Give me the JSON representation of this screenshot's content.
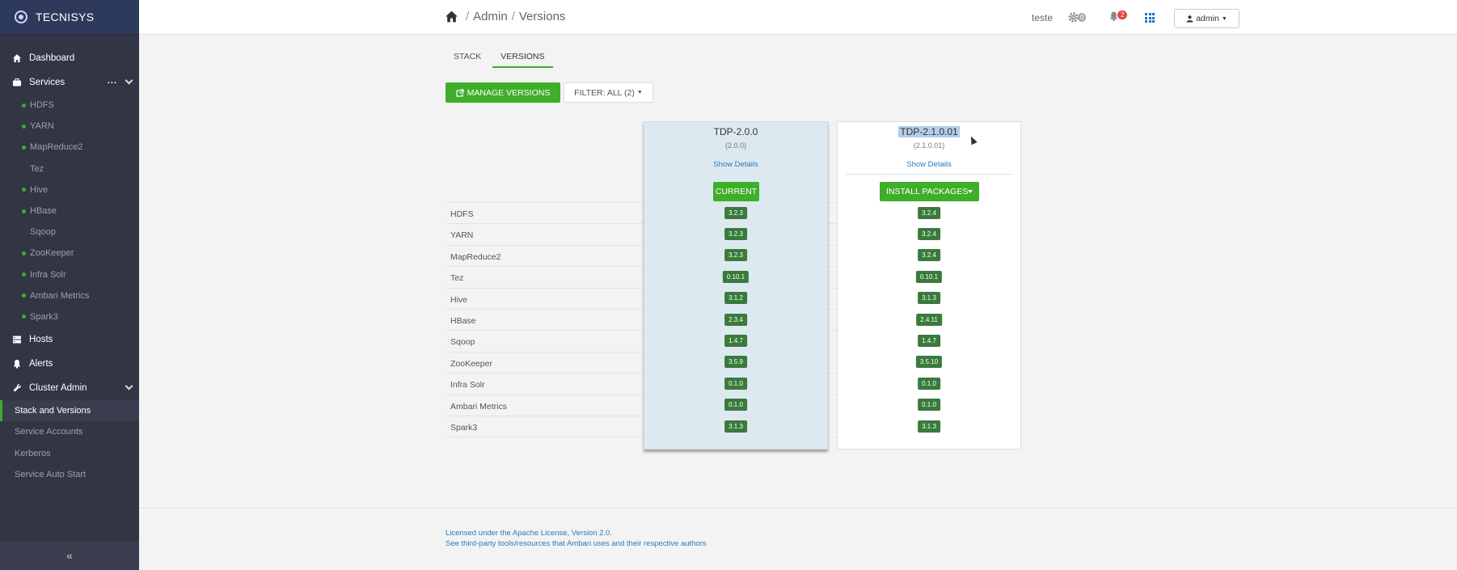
{
  "brand": {
    "name": "TECNISYS"
  },
  "sidebar": {
    "dashboard": "Dashboard",
    "services": "Services",
    "services_more": "...",
    "service_items": [
      {
        "label": "HDFS",
        "status": "green"
      },
      {
        "label": "YARN",
        "status": "green"
      },
      {
        "label": "MapReduce2",
        "status": "green"
      },
      {
        "label": "Tez",
        "status": "none"
      },
      {
        "label": "Hive",
        "status": "green"
      },
      {
        "label": "HBase",
        "status": "green"
      },
      {
        "label": "Sqoop",
        "status": "none"
      },
      {
        "label": "ZooKeeper",
        "status": "green"
      },
      {
        "label": "Infra Solr",
        "status": "green"
      },
      {
        "label": "Ambari Metrics",
        "status": "green"
      },
      {
        "label": "Spark3",
        "status": "green"
      }
    ],
    "hosts": "Hosts",
    "alerts": "Alerts",
    "cluster_admin": "Cluster Admin",
    "admin_items": [
      "Stack and Versions",
      "Service Accounts",
      "Kerberos",
      "Service Auto Start"
    ],
    "active_admin_item": "Stack and Versions",
    "collapse_icon": "double-chevron-left-icon"
  },
  "header": {
    "breadcrumb": [
      "Admin",
      "Versions"
    ],
    "user": "teste",
    "ops_count": "0",
    "alerts_count": "2",
    "admin_menu": "admin"
  },
  "tabs": [
    "STACK",
    "VERSIONS"
  ],
  "active_tab": "VERSIONS",
  "toolbar": {
    "manage_versions": "MANAGE VERSIONS",
    "filter": "FILTER: ALL (2)"
  },
  "services": [
    "HDFS",
    "YARN",
    "MapReduce2",
    "Tez",
    "Hive",
    "HBase",
    "Sqoop",
    "ZooKeeper",
    "Infra Solr",
    "Ambari Metrics",
    "Spark3"
  ],
  "versions": [
    {
      "name": "TDP-2.0.0",
      "sub": "(2.0.0)",
      "details": "Show Details",
      "action": "CURRENT",
      "service_versions": [
        "3.2.3",
        "3.2.3",
        "3.2.3",
        "0.10.1",
        "3.1.2",
        "2.3.4",
        "1.4.7",
        "3.5.9",
        "0.1.0",
        "0.1.0",
        "3.1.3"
      ]
    },
    {
      "name": "TDP-2.1.0.01",
      "sub": "(2.1.0.01)",
      "details": "Show Details",
      "action": "INSTALL PACKAGES",
      "service_versions": [
        "3.2.4",
        "3.2.4",
        "3.2.4",
        "0.10.1",
        "3.1.3",
        "2.4.11",
        "1.4.7",
        "3.5.10",
        "0.1.0",
        "0.1.0",
        "3.1.3"
      ]
    }
  ],
  "footer": {
    "license": "Licensed under the Apache License, Version 2.0.",
    "third_party": "See third-party tools/resources that Ambari uses and their respective authors"
  }
}
